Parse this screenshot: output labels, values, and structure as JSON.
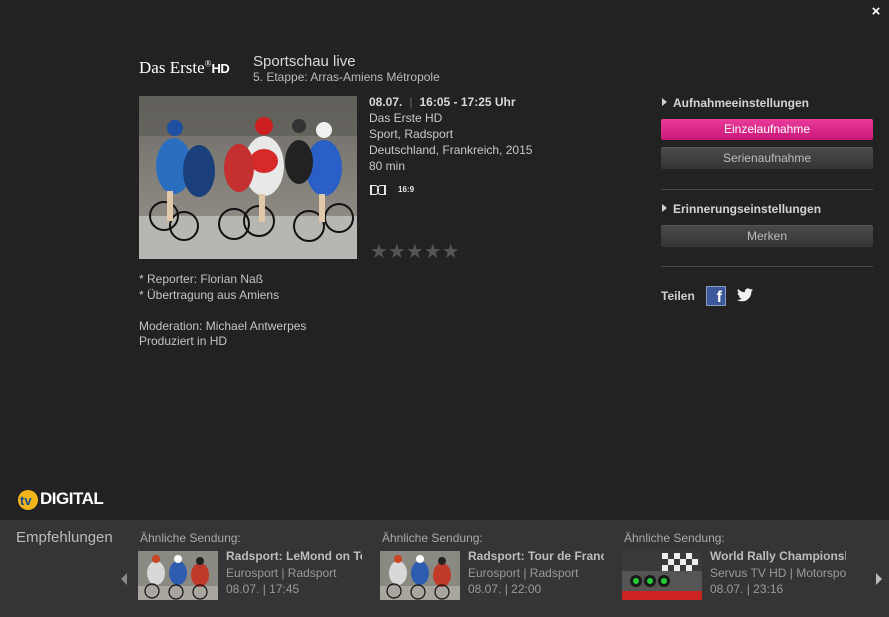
{
  "close_icon": "×",
  "channel": {
    "logo_text": "Das Erste",
    "logo_circle": "®",
    "logo_hd": "HD"
  },
  "show": {
    "title": "Sportschau live",
    "subtitle": "5. Etappe: Arras-Amiens Métropole",
    "date": "08.07.",
    "time": "16:05 - 17:25 Uhr",
    "channel_name": "Das Erste HD",
    "genre": "Sport, Radsport",
    "country_year": "Deutschland, Frankreich, 2015",
    "duration": "80 min",
    "aspect_ratio": "16:9",
    "rating_stars": "★★★★★",
    "rating_value": 0,
    "description_1": "* Reporter: Florian Naß",
    "description_2": "* Übertragung aus Amiens",
    "moderation": "Moderation: Michael Antwerpes",
    "production": "Produziert in HD"
  },
  "recording": {
    "heading": "Aufnahmeeinstellungen",
    "single_label": "Einzelaufnahme",
    "series_label": "Serienaufnahme"
  },
  "reminder": {
    "heading": "Erinnerungseinstellungen",
    "remember_label": "Merken"
  },
  "share": {
    "label": "Teilen",
    "facebook_glyph": "f"
  },
  "brand": {
    "tv": "tv",
    "digital": "DIGITAL"
  },
  "recommendations": {
    "title": "Empfehlungen",
    "items": [
      {
        "heading": "Ähnliche Sendung:",
        "title": "Radsport: LeMond on Tour",
        "channel": "Eurosport | Radsport",
        "time": "08.07.  |  17:45",
        "thumb": "cycling"
      },
      {
        "heading": "Ähnliche Sendung:",
        "title": "Radsport: Tour de France",
        "channel": "Eurosport | Radsport",
        "time": "08.07.  |  22:00",
        "thumb": "cycling"
      },
      {
        "heading": "Ähnliche Sendung:",
        "title": "World Rally Championship",
        "channel": "Servus TV HD | Motorsport",
        "time": "08.07.  |  23:16",
        "thumb": "rally"
      }
    ]
  },
  "colors": {
    "background": "#222223",
    "accent": "#d61f84",
    "recommend_bar": "#353535"
  }
}
